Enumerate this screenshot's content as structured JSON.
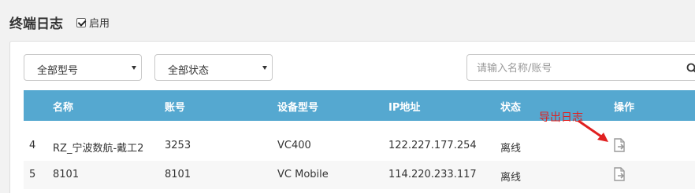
{
  "header": {
    "title": "终端日志",
    "enable_label": "启用",
    "enable_checked": true
  },
  "filters": {
    "model_select": "全部型号",
    "status_select": "全部状态",
    "search_placeholder": "请输入名称/账号"
  },
  "table": {
    "columns": [
      "名称",
      "账号",
      "设备型号",
      "IP地址",
      "状态",
      "操作"
    ],
    "rows": [
      {
        "index": "4",
        "name": "RZ_宁波数航-戴工2",
        "account": "3253",
        "model": "VC400",
        "ip": "122.227.177.254",
        "status": "离线",
        "action_icon": "export-log-icon"
      },
      {
        "index": "5",
        "name": "8101",
        "account": "8101",
        "model": "VC Mobile",
        "ip": "114.220.233.117",
        "status": "离线",
        "action_icon": "export-log-icon"
      }
    ]
  },
  "annotation": {
    "text": "导出日志",
    "color": "#e02020"
  },
  "colors": {
    "table_header": "#55a8d0",
    "background": "#f2f2f2"
  }
}
